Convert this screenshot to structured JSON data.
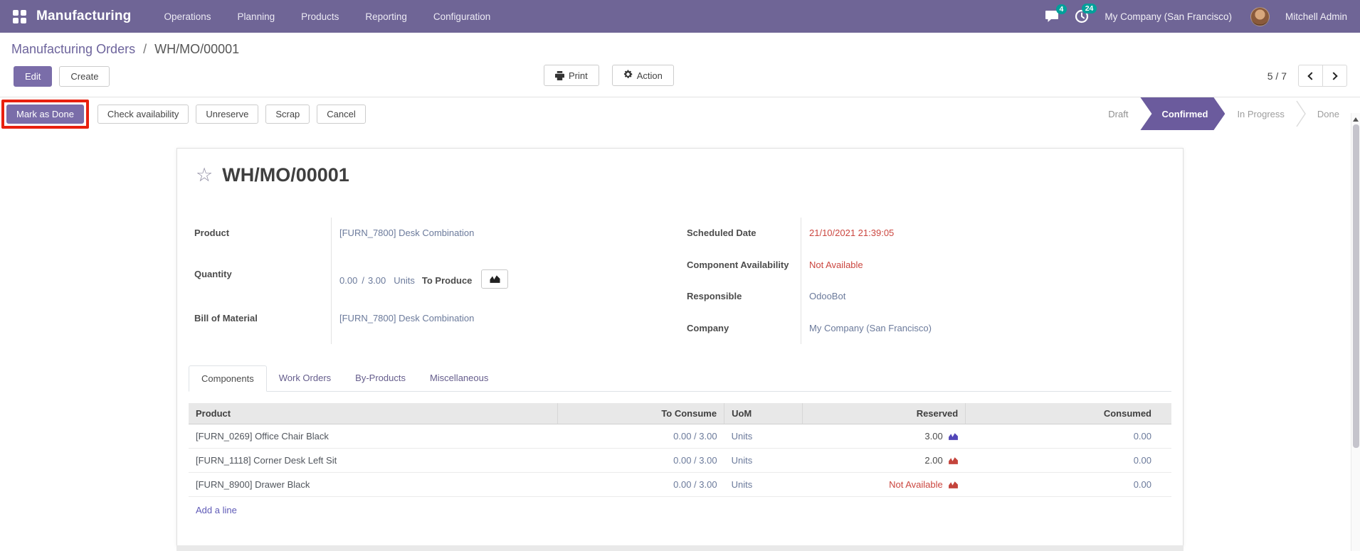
{
  "topbar": {
    "brand": "Manufacturing",
    "menus": [
      "Operations",
      "Planning",
      "Products",
      "Reporting",
      "Configuration"
    ],
    "messages_badge": "4",
    "activities_badge": "24",
    "company": "My Company (San Francisco)",
    "user": "Mitchell Admin",
    "badge_color": "#00A09A",
    "bar_color": "#6F6596"
  },
  "breadcrumb": {
    "parent": "Manufacturing Orders",
    "separator": "/",
    "current": "WH/MO/00001"
  },
  "control_panel": {
    "edit_label": "Edit",
    "create_label": "Create",
    "print_label": "Print",
    "action_label": "Action",
    "pager_counter": "5 / 7"
  },
  "statusbar": {
    "buttons": [
      {
        "label": "Mark as Done",
        "style": "primary",
        "highlighted": true
      },
      {
        "label": "Check availability",
        "style": "default"
      },
      {
        "label": "Unreserve",
        "style": "default"
      },
      {
        "label": "Scrap",
        "style": "default"
      },
      {
        "label": "Cancel",
        "style": "default"
      }
    ],
    "highlight_color": "#E8200F",
    "states": [
      {
        "label": "Draft",
        "active": false
      },
      {
        "label": "Confirmed",
        "active": true
      },
      {
        "label": "In Progress",
        "active": false
      },
      {
        "label": "Done",
        "active": false
      }
    ],
    "active_state_color": "#6B5B9D"
  },
  "form": {
    "title": "WH/MO/00001",
    "fields_left": {
      "product": {
        "label": "Product",
        "value": "[FURN_7800] Desk Combination"
      },
      "quantity": {
        "label": "Quantity",
        "produced": "0.00",
        "separator": "/",
        "total": "3.00",
        "uom": "Units",
        "suffix": "To Produce"
      },
      "bom": {
        "label": "Bill of Material",
        "value": "[FURN_7800] Desk Combination"
      }
    },
    "fields_right": {
      "scheduled_date": {
        "label": "Scheduled Date",
        "value": "21/10/2021 21:39:05"
      },
      "component_availability": {
        "label": "Component Availability",
        "value": "Not Available"
      },
      "responsible": {
        "label": "Responsible",
        "value": "OdooBot"
      },
      "company": {
        "label": "Company",
        "value": "My Company (San Francisco)"
      }
    },
    "tabs": [
      {
        "label": "Components",
        "active": true
      },
      {
        "label": "Work Orders",
        "active": false
      },
      {
        "label": "By-Products",
        "active": false
      },
      {
        "label": "Miscellaneous",
        "active": false
      }
    ]
  },
  "components_table": {
    "columns": [
      "Product",
      "To Consume",
      "UoM",
      "Reserved",
      "Consumed"
    ],
    "rows": [
      {
        "product": "[FURN_0269] Office Chair Black",
        "to_consume": "0.00 / 3.00",
        "uom": "Units",
        "reserved": "3.00",
        "reserved_state": "ok",
        "consumed": "0.00"
      },
      {
        "product": "[FURN_1118] Corner Desk Left Sit",
        "to_consume": "0.00 / 3.00",
        "uom": "Units",
        "reserved": "2.00",
        "reserved_state": "danger",
        "consumed": "0.00"
      },
      {
        "product": "[FURN_8900] Drawer Black",
        "to_consume": "0.00 / 3.00",
        "uom": "Units",
        "reserved": "Not Available",
        "reserved_state": "danger",
        "consumed": "0.00"
      }
    ],
    "add_line_label": "Add a line"
  }
}
